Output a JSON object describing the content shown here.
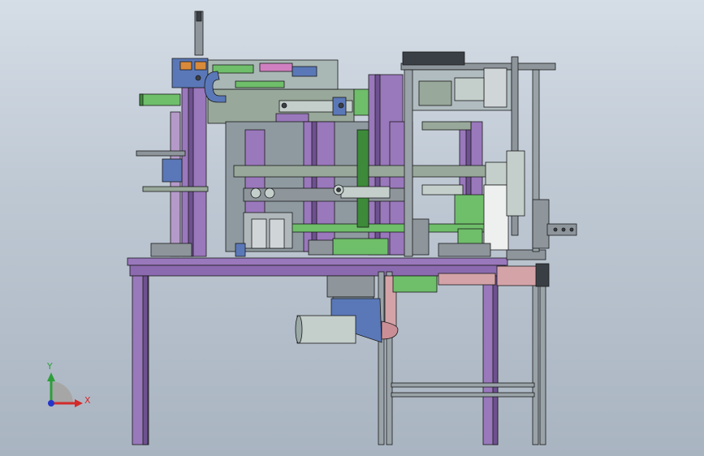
{
  "viewport": {
    "background_top": "#d5dde6",
    "background_bottom": "#a9b4c1"
  },
  "triad": {
    "y_label": "Y",
    "x_label": "X",
    "y_color": "#2e9e3a",
    "x_color": "#d42a2a",
    "z_color": "#2436c9"
  },
  "colors": {
    "frame_purple": "#9a78bc",
    "frame_purple_dark": "#6e5190",
    "steel_gray": "#8e969c",
    "green_part": "#6fbe6a",
    "olive_plate": "#98a89a",
    "blue_part": "#5a78b8",
    "pink_tube": "#d4a3a8",
    "outline": "#1a1a1a"
  }
}
